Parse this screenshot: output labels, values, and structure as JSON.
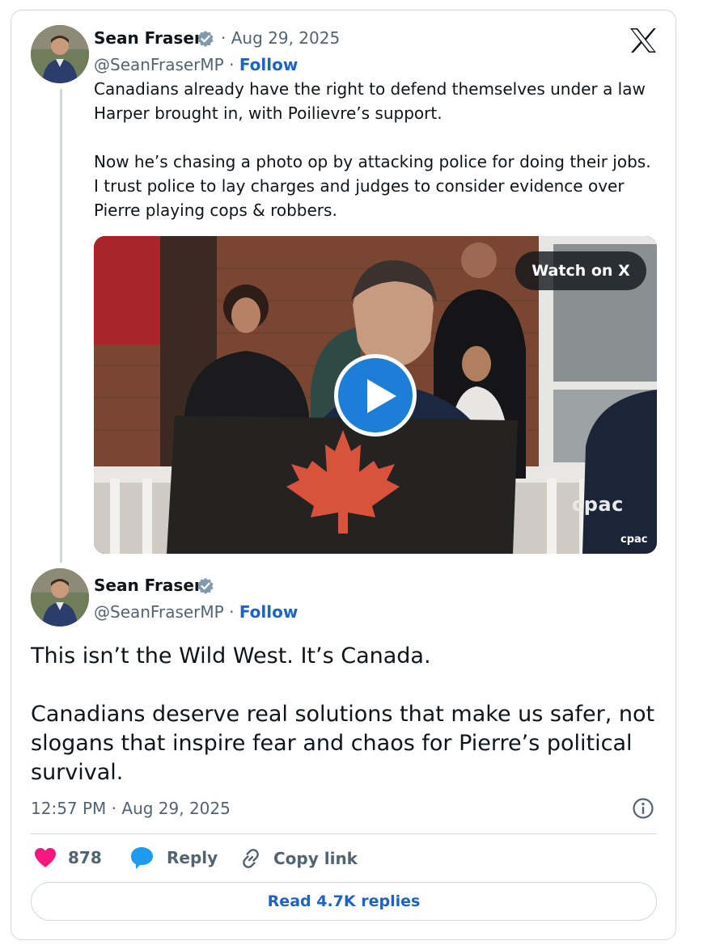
{
  "tweet1": {
    "author": "Sean Fraser",
    "date_sep": "·",
    "date": "Aug 29, 2025",
    "handle": "@SeanFraserMP",
    "follow_sep": "·",
    "follow_label": "Follow",
    "paragraphs": [
      "Canadians already have the right to defend themselves under a law Harper brought in, with Poilievre’s support.",
      "Now he’s chasing a photo op by attacking police for doing their jobs. I trust police to lay charges and judges to consider evidence over Pierre playing cops & robbers."
    ],
    "video": {
      "watch_label": "Watch on X",
      "watermark": "cpac",
      "corner_logo": "cpac"
    }
  },
  "tweet2": {
    "author": "Sean Fraser",
    "handle": "@SeanFraserMP",
    "follow_sep": "·",
    "follow_label": "Follow",
    "paragraphs": [
      "This isn’t the Wild West. It’s Canada.",
      "Canadians deserve real solutions that make us safer, not slogans that inspire fear and chaos for Pierre’s political survival."
    ],
    "timestamp": "12:57 PM · Aug 29, 2025"
  },
  "actions": {
    "like_count": "878",
    "reply_label": "Reply",
    "copy_label": "Copy link"
  },
  "read_replies_label": "Read 4.7K replies",
  "icons": {
    "verified": "verified-badge-icon",
    "x_logo": "x-logo-icon",
    "heart": "heart-icon",
    "reply": "reply-bubble-icon",
    "link": "link-icon",
    "info": "info-icon",
    "play": "play-icon"
  },
  "colors": {
    "accent": "#1d63c3",
    "heart": "#f91880",
    "reply_icon": "#1d9bf0",
    "muted": "#536471",
    "border": "#cfd9de"
  }
}
